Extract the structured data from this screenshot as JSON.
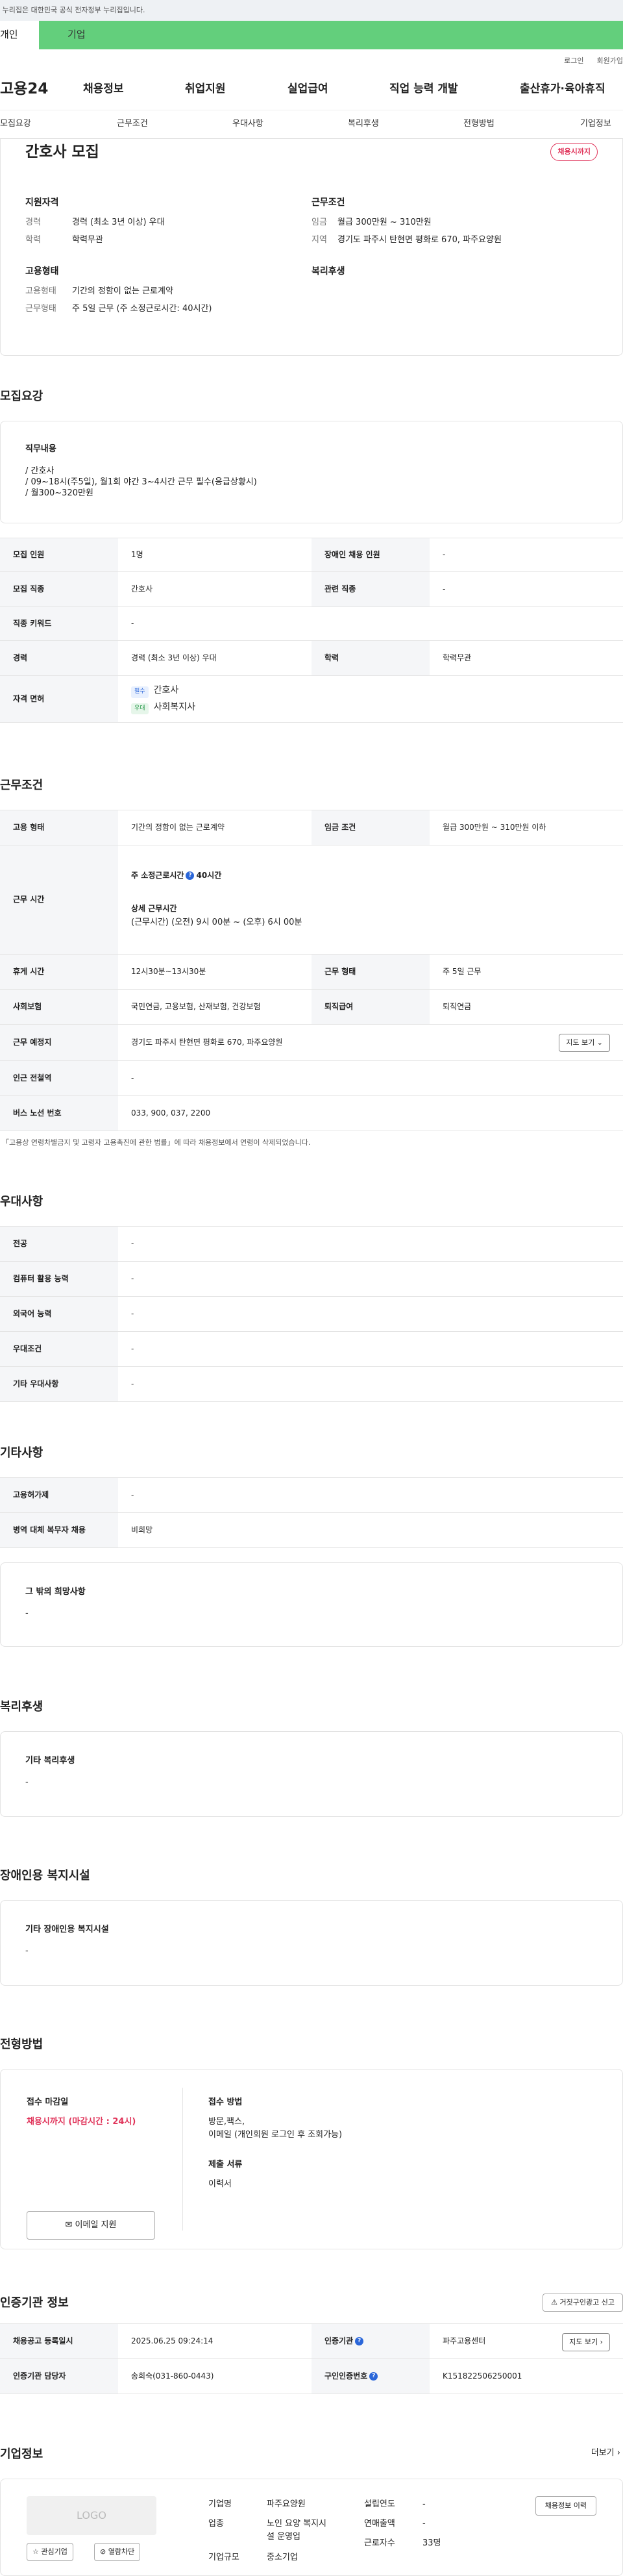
{
  "topbar": {
    "notice": "이 누리집은 대한민국 공식 전자정부 누리집입니다."
  },
  "usertabs": {
    "individual": "개인",
    "corporate": "기업"
  },
  "util": {
    "login": "로그인",
    "signup": "회원가입"
  },
  "gnb": {
    "logo": "고용24",
    "menu": [
      "채용정보",
      "취업지원",
      "실업급여",
      "직업 능력 개발",
      "출산휴가·육아휴직"
    ]
  },
  "anchors": [
    "모집요강",
    "근무조건",
    "우대사항",
    "복리후생",
    "전형방법",
    "기업정보"
  ],
  "summary": {
    "title": "간호사 모집",
    "badge": "채용시까지",
    "qual": {
      "heading": "지원자격",
      "career_k": "경력",
      "career_v": "경력 (최소 3년 이상) 우대",
      "edu_k": "학력",
      "edu_v": "학력무관"
    },
    "cond": {
      "heading": "근무조건",
      "wage_k": "임금",
      "wage_v": "월급 300만원 ~ 310만원",
      "area_k": "지역",
      "area_v": "경기도 파주시 탄현면 평화로 670, 파주요양원"
    },
    "emp": {
      "heading": "고용형태",
      "type_k": "고용형태",
      "type_v": "기간의 정함이 없는 근로계약",
      "form_k": "근무형태",
      "form_v": "주 5일 근무 (주 소정근로시간: 40시간)"
    },
    "welfare": {
      "heading": "복리후생"
    }
  },
  "recruit": {
    "title": "모집요강",
    "duty_heading": "직무내용",
    "duty_lines": [
      "/ 간호사",
      "/ 09~18시(주5일), 월1회 야간 3~4시간 근무 필수(응급상황시)",
      "/ 월300~320만원"
    ],
    "rows": {
      "headcount_k": "모집 인원",
      "headcount_v": "1명",
      "disabled_k": "장애인 채용 인원",
      "disabled_v": "-",
      "job_k": "모집 직종",
      "job_v": "간호사",
      "related_k": "관련 직종",
      "related_v": "-",
      "keyword_k": "직종 키워드",
      "keyword_v": "-",
      "career_k": "경력",
      "career_v": "경력 (최소 3년 이상) 우대",
      "edu_k": "학력",
      "edu_v": "학력무관",
      "license_k": "자격 면허",
      "req_chip": "필수",
      "req_v": "간호사",
      "pref_chip": "우대",
      "pref_v": "사회복지사"
    }
  },
  "work": {
    "title": "근무조건",
    "type_k": "고용 형태",
    "type_v": "기간의 정함이 없는 근로계약",
    "wage_k": "임금 조건",
    "wage_v": "월급 300만원 ~ 310만원 이하",
    "hours_k": "근무 시간",
    "hours_week": "주 소정근로시간",
    "hours_week_v": "40시간",
    "hours_detail_h": "상세 근무시간",
    "hours_detail_v": "(근무시간) (오전) 9시 00분 ~ (오후) 6시 00분",
    "rest_k": "휴게 시간",
    "rest_v": "12시30분~13시30분",
    "form_k": "근무 형태",
    "form_v": "주 5일 근무",
    "ins_k": "사회보험",
    "ins_v": "국민연금, 고용보험, 산재보험, 건강보험",
    "pension_k": "퇴직급여",
    "pension_v": "퇴직연금",
    "place_k": "근무 예정지",
    "place_v": "경기도 파주시 탄현면 평화로 670, 파주요양원",
    "map_btn": "지도 보기",
    "subway_k": "인근 전철역",
    "subway_v": "-",
    "bus_k": "버스 노선 번호",
    "bus_v": "033, 900, 037, 2200",
    "note": "* 「고용상 연령차별금지 및 고령자 고용촉진에 관한 법률」에 따라 채용정보에서 연령이 삭제되었습니다."
  },
  "pref": {
    "title": "우대사항",
    "rows": [
      [
        "전공",
        "-"
      ],
      [
        "컴퓨터 활용 능력",
        "-"
      ],
      [
        "외국어 능력",
        "-"
      ],
      [
        "우대조건",
        "-"
      ],
      [
        "기타 우대사항",
        "-"
      ]
    ]
  },
  "etc": {
    "title": "기타사항",
    "rows": [
      [
        "고용허가제",
        "-"
      ],
      [
        "병역 대체 복무자 채용",
        "비희망"
      ]
    ],
    "wish_h": "그 밖의 희망사항",
    "wish_v": "-"
  },
  "welfare": {
    "title": "복리후생",
    "h": "기타 복리후생",
    "v": "-"
  },
  "disabled_fac": {
    "title": "장애인용 복지시설",
    "h": "기타 장애인용 복지시설",
    "v": "-"
  },
  "selection": {
    "title": "전형방법",
    "deadline_h": "접수 마감일",
    "deadline_v": "채용시까지 (마감시간 : 24시)",
    "method_h": "접수 방법",
    "method_v1": "방문,팩스,",
    "method_v2": "이메일 (개인회원 로그인 후 조회가능)",
    "docs_h": "제출 서류",
    "docs_v": "이력서",
    "email_btn": "이메일 지원"
  },
  "cert": {
    "title": "인증기관 정보",
    "report_btn": "거짓구인광고 신고",
    "reg_k": "채용공고 등록일시",
    "reg_v": "2025.06.25 09:24:14",
    "org_k": "인증기관",
    "org_v": "파주고용센터",
    "detail_btn": "지도 보기",
    "staff_k": "인증기관 담당자",
    "staff_v": "송희숙(031-860-0443)",
    "num_k": "구인인증번호",
    "num_v": "K151822506250001"
  },
  "company": {
    "title": "기업정보",
    "more": "더보기",
    "logo": "LOGO",
    "fav_btn": "관심기업",
    "block_btn": "열람차단",
    "name_k": "기업명",
    "name_v": "파주요양원",
    "ind_k": "업종",
    "ind_v1": "노인 요양 복지시",
    "ind_v2": "설 운영업",
    "size_k": "기업규모",
    "size_v": "중소기업",
    "year_k": "설립연도",
    "year_v": "-",
    "sales_k": "연매출액",
    "sales_v": "-",
    "emp_k": "근로자수",
    "emp_v": "33명",
    "jobs_btn": "채용정보 이력"
  }
}
